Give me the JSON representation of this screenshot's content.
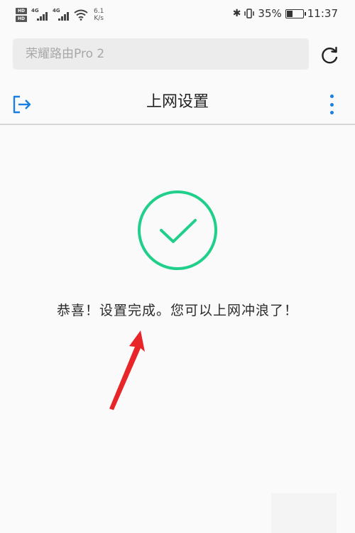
{
  "status_bar": {
    "network_type_1": "4G",
    "network_type_2": "4G",
    "speed_value": "6.1",
    "speed_unit": "K/s",
    "battery_percent": "35%",
    "battery_level": 0.35,
    "time": "11:37"
  },
  "address_bar": {
    "placeholder": "荣耀路由Pro 2"
  },
  "header": {
    "title": "上网设置"
  },
  "main": {
    "success_message": "恭喜！设置完成。您可以上网冲浪了！"
  },
  "colors": {
    "accent_blue": "#1a7fe0",
    "success_green": "#1fcf8a",
    "annotation_red": "#e8262a"
  },
  "icons": {
    "exit": "exit-icon",
    "refresh": "refresh-icon",
    "more": "more-vertical-icon",
    "success": "check-circle-icon"
  }
}
